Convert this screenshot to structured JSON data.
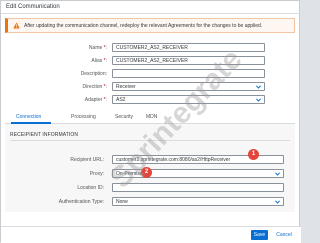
{
  "dialog": {
    "title": "Edit Communication"
  },
  "banner": {
    "text": "After updating the communication channel, redeploy the relevant Agreements for the changes to be applied."
  },
  "form": {
    "name": {
      "label": "Name",
      "required": "*",
      "value": "CUSTOMER2_AS2_RECEIVER"
    },
    "alias": {
      "label": "Alias",
      "required": "*",
      "value": "CUSTOMER2_AS2_RECEIVER"
    },
    "description": {
      "label": "Description",
      "value": ""
    },
    "direction": {
      "label": "Direction",
      "required": "*",
      "value": "Receiver"
    },
    "adapter": {
      "label": "Adapter",
      "required": "*",
      "value": "AS2"
    }
  },
  "tabs": [
    {
      "label": "Connection"
    },
    {
      "label": "Processing"
    },
    {
      "label": "Security"
    },
    {
      "label": "MDN"
    }
  ],
  "recipient": {
    "section_title": "RECEIPIENT INFORMATION",
    "url": {
      "label": "Recipient URL",
      "value": "customer2.sprintegrate.com:8080/as2/HttpReceiver"
    },
    "proxy": {
      "label": "Proxy",
      "value": "On-Premise"
    },
    "location_id": {
      "label": "Location ID",
      "value": ""
    },
    "auth": {
      "label": "Authentication Type",
      "value": "None"
    }
  },
  "markers": [
    "1",
    "2"
  ],
  "watermark": "Sprintegrate",
  "footer": {
    "save": "Save",
    "cancel": "Cancel"
  },
  "colors": {
    "accent": "#0a6ed1",
    "warning": "#e9730c",
    "marker": "#e2463b"
  }
}
